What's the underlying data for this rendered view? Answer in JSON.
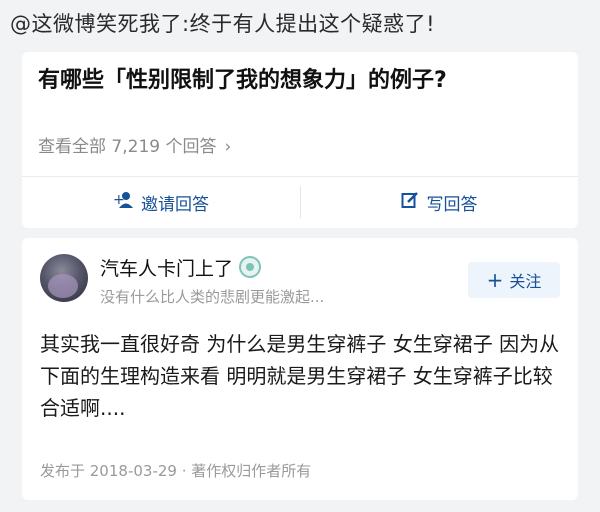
{
  "caption": "@这微博笑死我了:终于有人提出这个疑惑了!",
  "question": {
    "title": "有哪些「性别限制了我的想象力」的例子?",
    "view_all": "查看全部 7,219 个回答",
    "view_all_chevron": "›",
    "invite_label": "邀请回答",
    "invite_icon": "add-user-icon",
    "write_label": "写回答",
    "write_icon": "edit-icon"
  },
  "answer": {
    "author_name": "汽车人卡门上了",
    "author_bio": "没有什么比人类的悲剧更能激起...",
    "follow_label": "关注",
    "follow_plus": "+",
    "content": "其实我一直很好奇 为什么是男生穿裤子 女生穿裙子 因为从下面的生理构造来看 明明就是男生穿裙子 女生穿裤子比较合适啊....",
    "meta": "发布于 2018-03-29 · 著作权归作者所有"
  },
  "colors": {
    "accent": "#175199",
    "muted": "#8a8a8a",
    "background": "#f2f3f5"
  }
}
